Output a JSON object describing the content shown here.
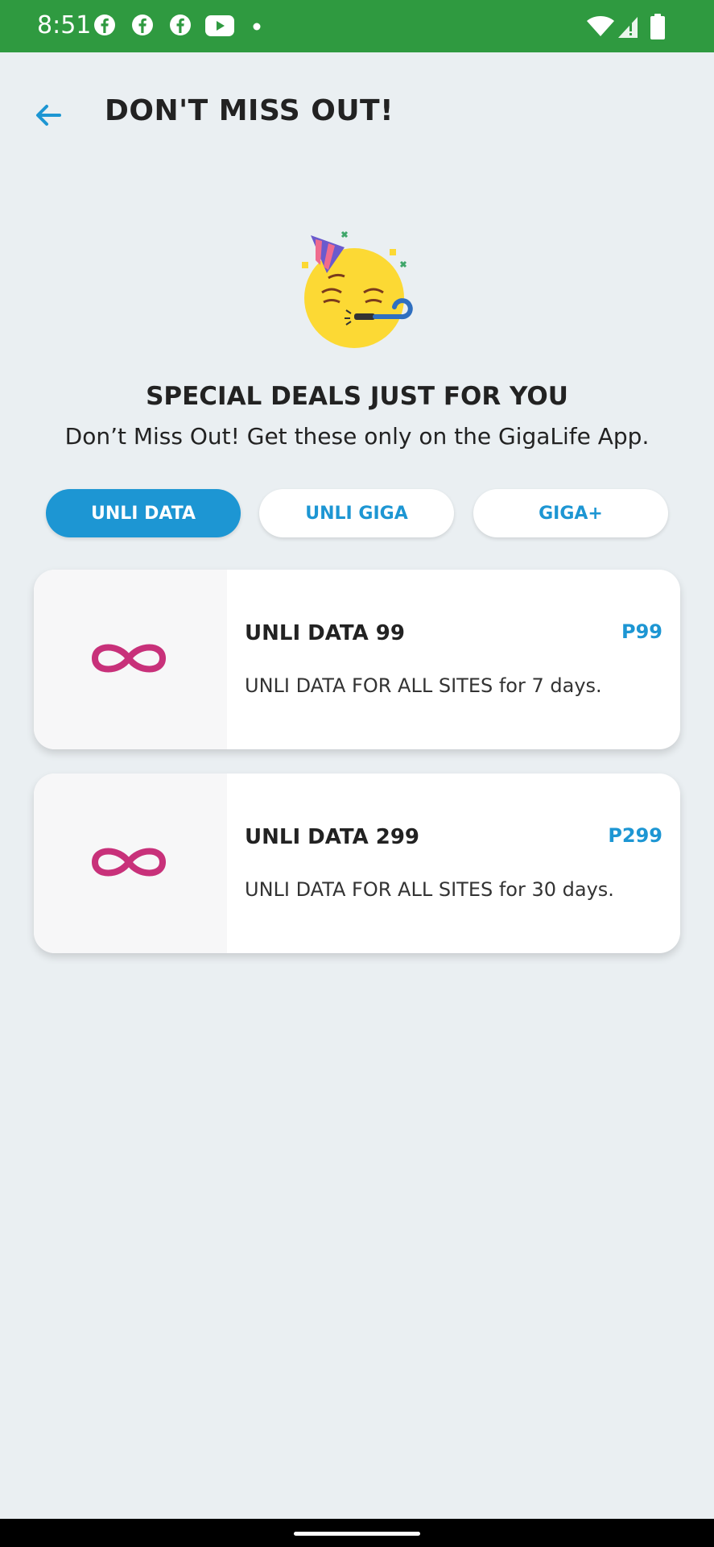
{
  "status_bar": {
    "time": "8:51",
    "icons": [
      "facebook-icon",
      "facebook-icon",
      "facebook-icon",
      "youtube-icon",
      "dot-icon",
      "wifi-icon",
      "signal-icon",
      "battery-icon"
    ]
  },
  "header": {
    "title": "DON'T MISS OUT!",
    "back_icon": "arrow-left-icon"
  },
  "hero": {
    "icon": "party-face-icon",
    "headline": "SPECIAL DEALS JUST FOR YOU",
    "subline": "Don’t Miss Out! Get these only on the GigaLife App."
  },
  "tabs": [
    {
      "label": "UNLI DATA",
      "active": true
    },
    {
      "label": "UNLI GIGA",
      "active": false
    },
    {
      "label": "GIGA+",
      "active": false
    }
  ],
  "offers": [
    {
      "title": "UNLI DATA 99",
      "price": "P99",
      "description": "UNLI DATA FOR ALL SITES for 7 days.",
      "icon": "infinity-icon"
    },
    {
      "title": "UNLI DATA 299",
      "price": "P299",
      "description": "UNLI DATA FOR ALL SITES for 30 days.",
      "icon": "infinity-icon"
    }
  ],
  "colors": {
    "status_bar": "#2f9a40",
    "accent": "#1d96d3",
    "infinity": "#c8317a",
    "background": "#eaeff2"
  }
}
